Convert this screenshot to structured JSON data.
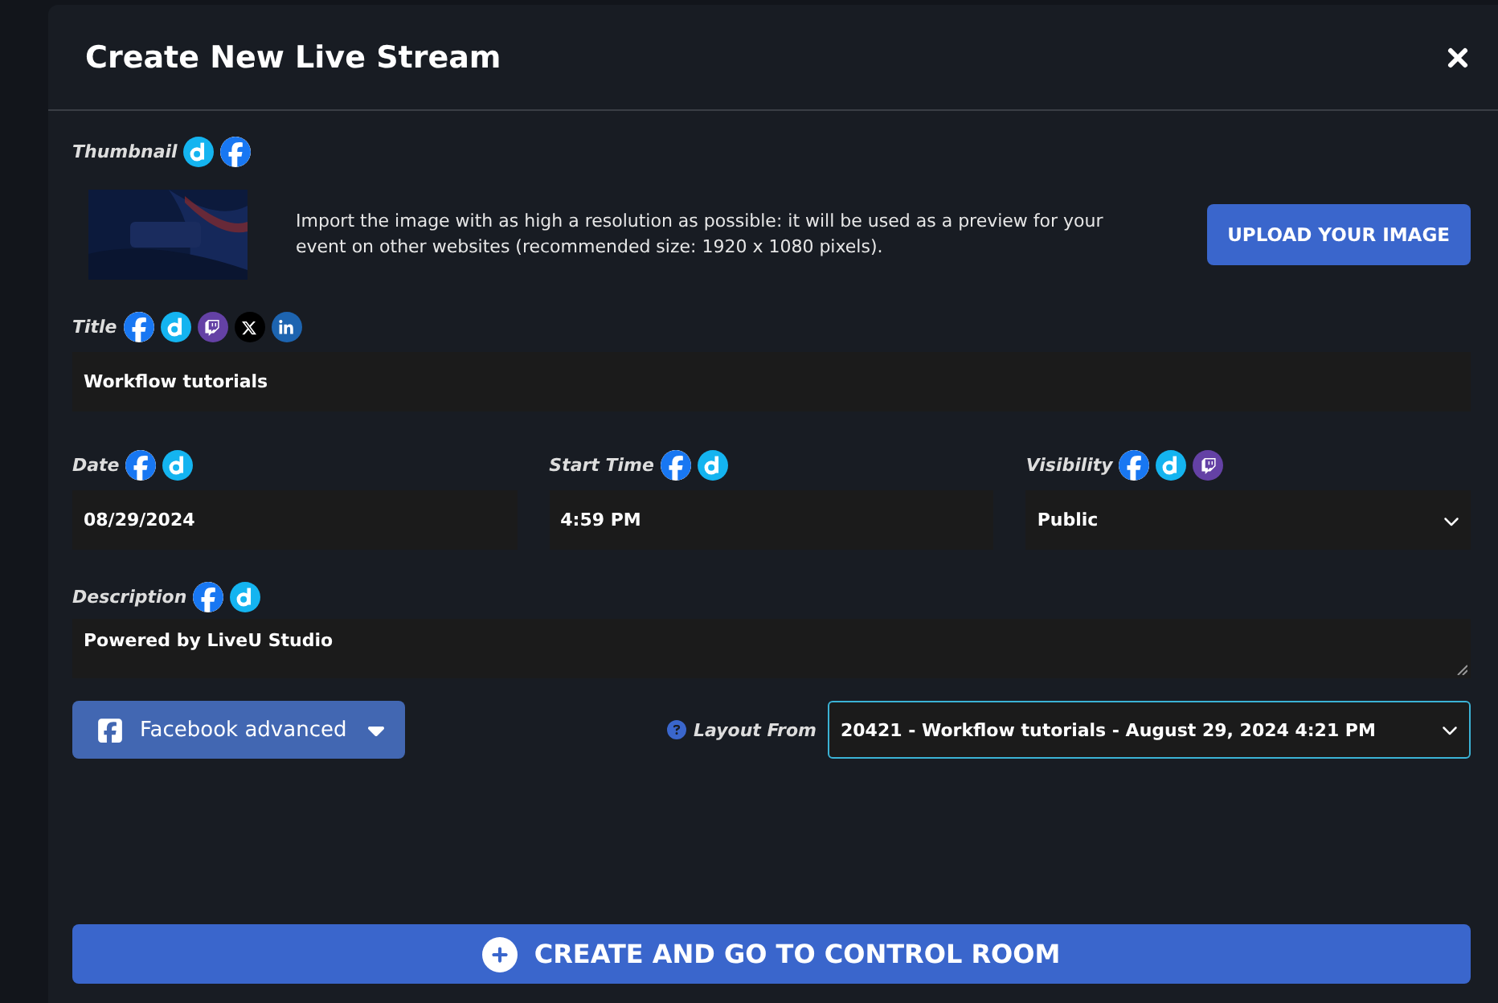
{
  "dialog": {
    "title": "Create New Live Stream"
  },
  "thumbnail": {
    "label": "Thumbnail",
    "platforms": [
      {
        "kind": "dailymotion"
      },
      {
        "kind": "facebook"
      }
    ],
    "hint": "Import the image with as high a resolution as possible: it will be used as a preview for your event on other websites (recommended size: 1920 x 1080 pixels).",
    "upload_button": "UPLOAD YOUR IMAGE"
  },
  "fields": [
    {
      "label": "Title",
      "kind": "text",
      "value": "Workflow tutorials",
      "platforms": [
        {
          "kind": "facebook"
        },
        {
          "kind": "dailymotion"
        },
        {
          "kind": "twitch"
        },
        {
          "kind": "x"
        },
        {
          "kind": "linkedin"
        }
      ]
    },
    {
      "label": "Date",
      "kind": "text",
      "value": "08/29/2024",
      "platforms": [
        {
          "kind": "facebook"
        },
        {
          "kind": "dailymotion"
        }
      ]
    },
    {
      "label": "Start Time",
      "kind": "text",
      "value": "4:59 PM",
      "platforms": [
        {
          "kind": "facebook"
        },
        {
          "kind": "dailymotion"
        }
      ]
    },
    {
      "label": "Visibility",
      "kind": "select",
      "value": "Public",
      "platforms": [
        {
          "kind": "facebook"
        },
        {
          "kind": "dailymotion"
        },
        {
          "kind": "twitch"
        }
      ]
    },
    {
      "label": "Description",
      "kind": "textarea",
      "value": "Powered by LiveU Studio",
      "platforms": [
        {
          "kind": "facebook"
        },
        {
          "kind": "dailymotion"
        }
      ]
    }
  ],
  "advanced_button": "Facebook advanced",
  "layout_from": {
    "label": "Layout From",
    "value": "20421 - Workflow tutorials - August 29, 2024 4:21 PM"
  },
  "create_button": "CREATE AND GO TO CONTROL ROOM"
}
